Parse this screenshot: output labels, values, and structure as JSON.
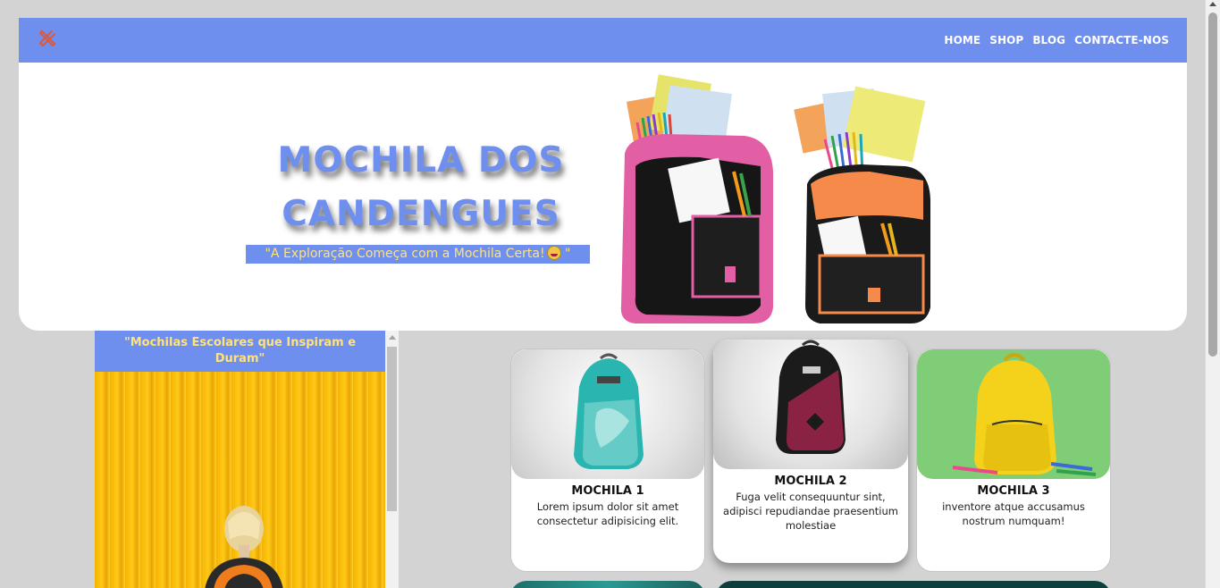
{
  "header": {
    "logo_icon": "pencil-ruler-icon",
    "nav": [
      "HOME",
      "SHOP",
      "BLOG",
      "CONTACTE-NOS"
    ]
  },
  "hero": {
    "title": "MOCHILA DOS CANDENGUES",
    "subtitle": "\"A Exploração Começa com a Mochila Certa!",
    "subtitle_end": " \"",
    "subtitle_emoji": "star-struck-emoji",
    "image": "school-backpacks-pink-orange"
  },
  "sidebar": {
    "heading": "\"Mochilas Escolares que Inspiram e Duram\"",
    "image": "girl-with-orange-backpack-yellow-wall"
  },
  "cards": [
    {
      "title": "MOCHILA 1",
      "text": "Lorem ipsum dolor sit amet consectetur adipisicing elit.",
      "image": "teal-backpack"
    },
    {
      "title": "MOCHILA 2",
      "text": "Fuga velit consequuntur sint, adipisci repudiandae praesentium molestiae",
      "image": "black-pink-backpack"
    },
    {
      "title": "MOCHILA 3",
      "text": "inventore atque accusamus nostrum numquam!",
      "image": "yellow-backpack"
    }
  ],
  "colors": {
    "accent": "#6f8fef",
    "accent_text": "#ffe27a",
    "background": "#d3d3d3"
  }
}
